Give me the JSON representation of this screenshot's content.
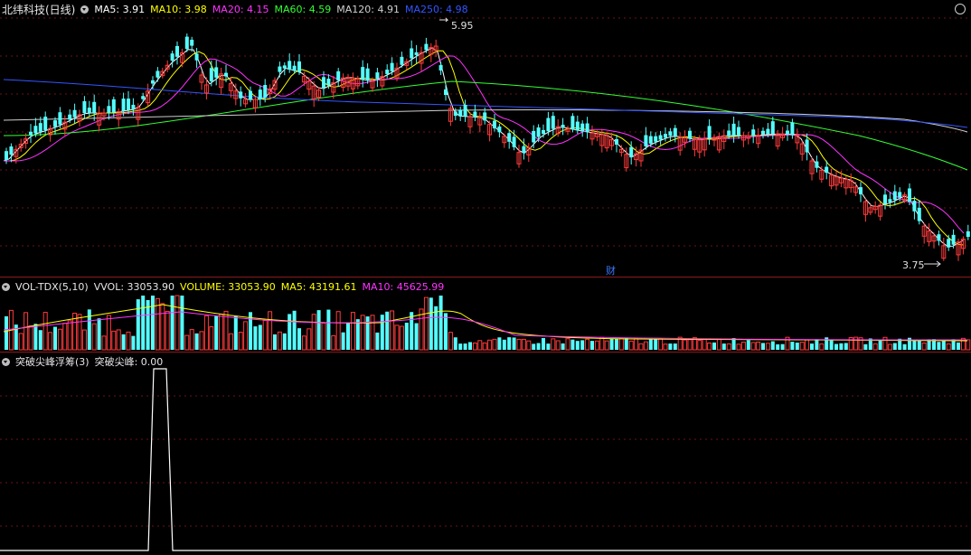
{
  "price_panel": {
    "title": "北纬科技(日线)",
    "indicators": [
      {
        "label": "MA5: 3.91",
        "color": "#ffffff"
      },
      {
        "label": "MA10: 3.98",
        "color": "#ffff00"
      },
      {
        "label": "MA20: 4.15",
        "color": "#ff33ff"
      },
      {
        "label": "MA60: 4.59",
        "color": "#33ff33"
      },
      {
        "label": "MA120: 4.91",
        "color": "#d0d0d0"
      },
      {
        "label": "MA250: 4.98",
        "color": "#3355ff"
      }
    ],
    "high_label": "5.95",
    "low_label": "3.75",
    "marker": "财"
  },
  "volume_panel": {
    "title": "VOL-TDX(5,10)",
    "indicators": [
      {
        "label": "VVOL: 33053.90",
        "color": "#e6e6e6"
      },
      {
        "label": "VOLUME: 33053.90",
        "color": "#ffff00"
      },
      {
        "label": "MA5: 43191.61",
        "color": "#ffff00"
      },
      {
        "label": "MA10: 45625.99",
        "color": "#ff33ff"
      }
    ]
  },
  "indicator_panel": {
    "title": "突破尖峰浮筹(3)",
    "indicators": [
      {
        "label": "突破尖峰: 0.00",
        "color": "#e6e6e6"
      }
    ]
  },
  "colors": {
    "up": "#ff3b3b",
    "down": "#54ffff",
    "grid": "#6a1414",
    "background": "#000000"
  }
}
